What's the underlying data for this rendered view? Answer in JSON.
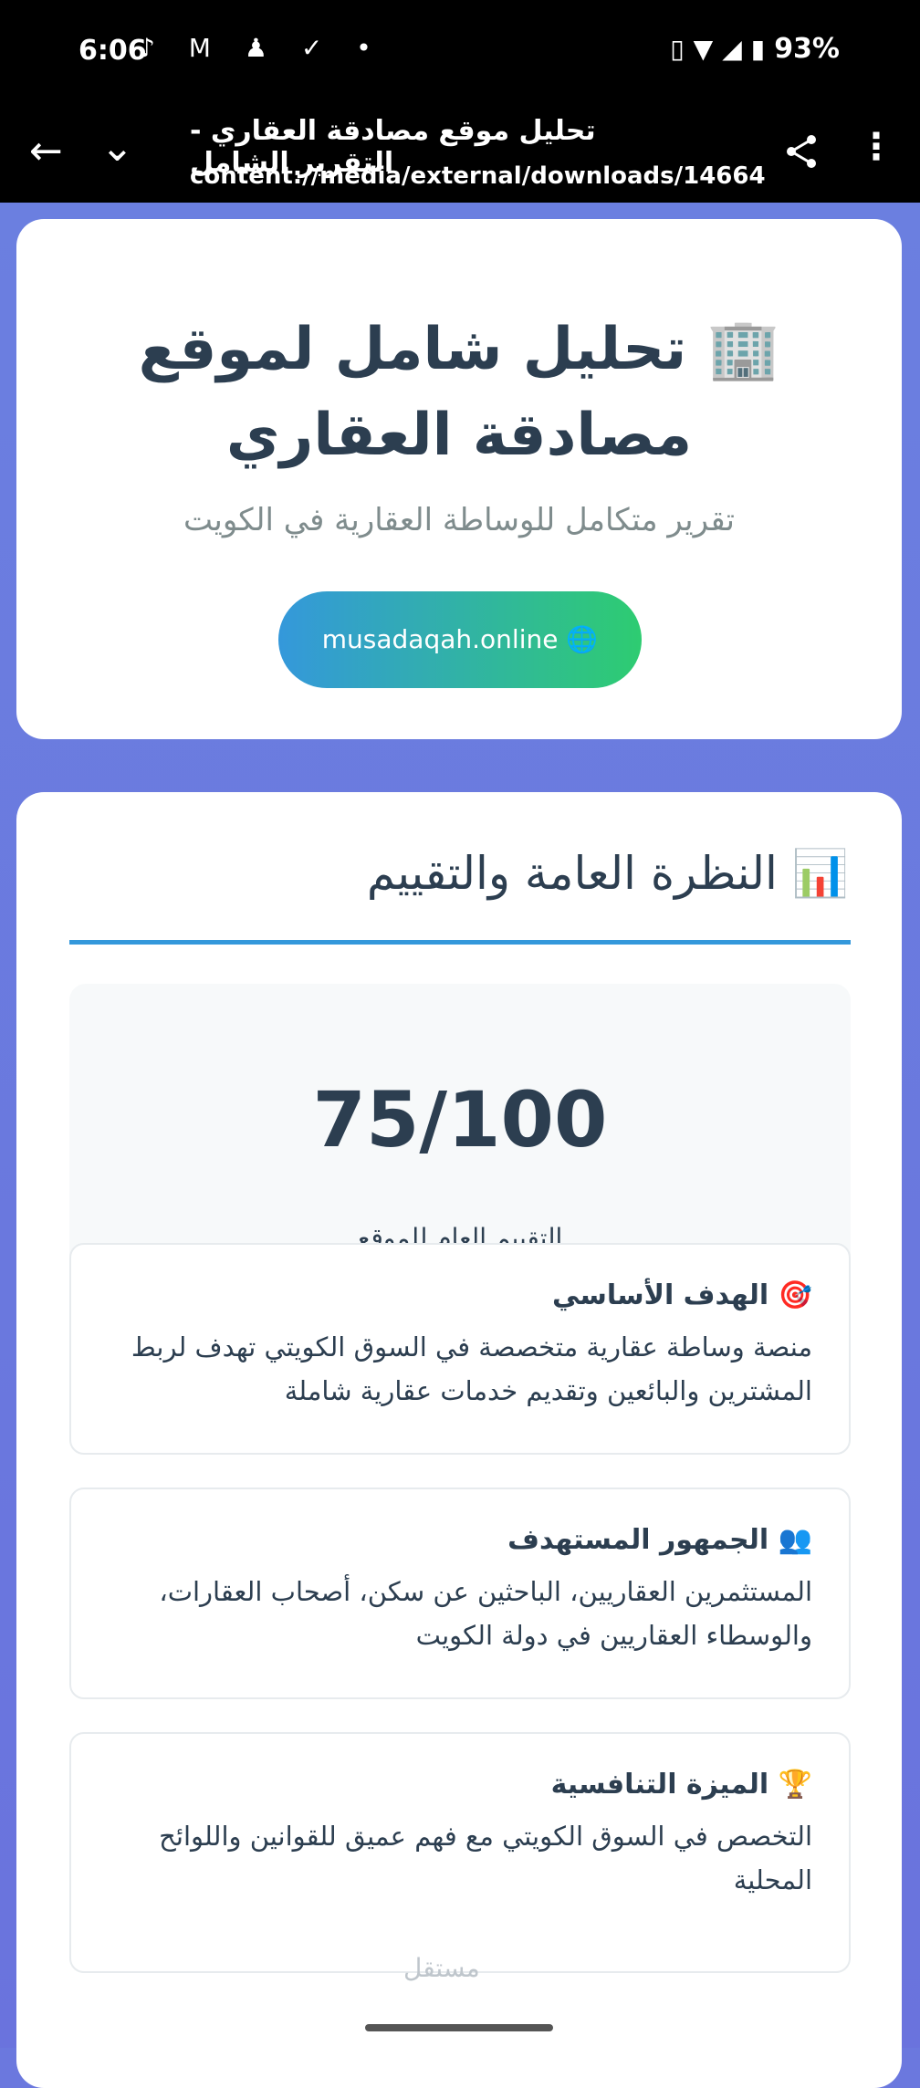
{
  "status": {
    "time": "6:06",
    "battery": "93%"
  },
  "toolbar": {
    "title": "تحليل موقع مصادقة العقاري - التقرير الشامل",
    "url": "content://media/external/downloads/14664"
  },
  "hero": {
    "title": "🏢 تحليل شامل لموقع مصادقة العقاري",
    "subtitle": "تقرير متكامل للوساطة العقارية في الكويت",
    "site_button": "musadaqah.online 🌐"
  },
  "overview": {
    "title": "📊 النظرة العامة والتقييم",
    "score": "75/100",
    "score_label": "التقييم العام للموقع",
    "score_fraction": 0.75,
    "cards": [
      {
        "title": "🎯 الهدف الأساسي",
        "text": "منصة وساطة عقارية متخصصة في السوق الكويتي تهدف لربط المشترين والبائعين وتقديم خدمات عقارية شاملة"
      },
      {
        "title": "👥 الجمهور المستهدف",
        "text": "المستثمرين العقاريين، الباحثين عن سكن، أصحاب العقارات، والوسطاء العقاريين في دولة الكويت"
      },
      {
        "title": "🏆 الميزة التنافسية",
        "text": "التخصص في السوق الكويتي مع فهم عميق للقوانين واللوائح المحلية"
      }
    ]
  },
  "watermark": "مستقل"
}
